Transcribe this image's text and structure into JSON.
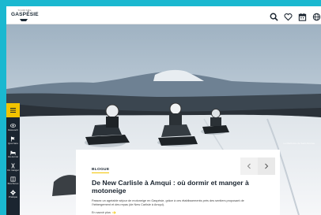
{
  "header": {
    "logo_small": "TOURISME",
    "logo_main": "GASPÉSIE",
    "icons": [
      "search-icon",
      "heart-icon",
      "calendar-icon",
      "globe-icon"
    ]
  },
  "hero": {
    "photo_credit": "Le Marbrière de Saint-Nicolas"
  },
  "sidebar": {
    "menu_icon": "hamburger-icon",
    "items": [
      {
        "icon": "eye-icon",
        "label": "Découvrir"
      },
      {
        "icon": "flag-icon",
        "label": "Quoi faire"
      },
      {
        "icon": "bed-icon",
        "label": "Où dormir"
      },
      {
        "icon": "utensils-icon",
        "label": "Où manger"
      },
      {
        "icon": "book-icon",
        "label": "Brochures"
      },
      {
        "icon": "gear-icon",
        "label": "Pratique"
      }
    ]
  },
  "card": {
    "tag": "BLOGUE",
    "title": "De New Carlisle à Amqui : où dormir et manger à motoneige",
    "text": "Passez un agréable séjour de motoneige en Gaspésie, grâce à ces établissements près des sentiers proposant de l'hébergement et des repas (de New Carlisle à Amqui).",
    "link": "En savoir plus"
  },
  "colors": {
    "accent": "#f2c300",
    "sidebar": "#1b2530",
    "frame": "#1ab8d0"
  }
}
